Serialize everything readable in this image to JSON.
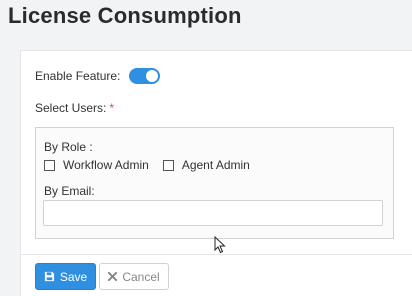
{
  "page": {
    "title": "License Consumption"
  },
  "form": {
    "enable_feature_label": "Enable Feature:",
    "enable_feature_on": true,
    "select_users_label": "Select Users:",
    "required_mark": "*",
    "by_role_label": "By Role :",
    "roles": [
      {
        "label": "Workflow Admin",
        "checked": false
      },
      {
        "label": "Agent Admin",
        "checked": false
      }
    ],
    "by_email_label": "By Email:",
    "email_value": "",
    "email_placeholder": ""
  },
  "actions": {
    "save_label": "Save",
    "cancel_label": "Cancel"
  },
  "icons": {
    "save": "floppy-disk-icon",
    "cancel": "x-icon"
  },
  "colors": {
    "accent": "#2f8fe0",
    "required": "#e04646"
  }
}
